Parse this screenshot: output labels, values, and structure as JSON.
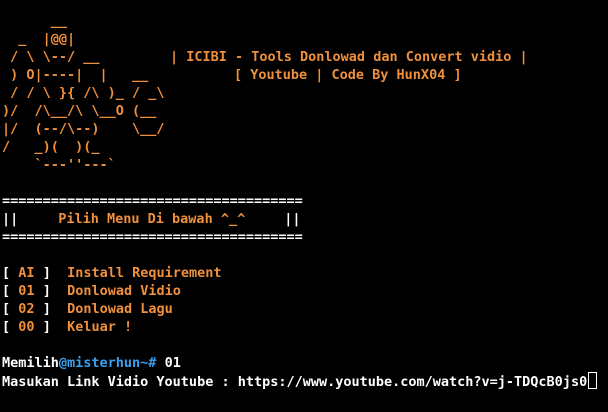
{
  "colors": {
    "background": "#000000",
    "accent_orange": "#f0903c",
    "text_white": "#ffffff",
    "host_blue": "#3aa0f0"
  },
  "banner": {
    "art": [
      "      __",
      "  _  |@@|",
      " / \\ \\--/ __",
      " ) O|----|  |   __",
      " / / \\ }{ /\\ )_ / _\\",
      ")/  /\\__/\\ \\__O (__",
      "|/  (--/\\--)    \\__/",
      "/   _)(  )(_",
      "    `---''---`"
    ],
    "title": "| ICIBI - Tools Donlowad dan Convert vidio |",
    "subtitle": "[ Youtube | Code By HunX04 ]"
  },
  "menu_box": {
    "border": "=====================================",
    "left_bar": "||",
    "title": "Pilih Menu Di bawah ^_^",
    "right_bar": "||"
  },
  "menu": {
    "items": [
      {
        "open": "[",
        "key": "AI",
        "close": "]",
        "label": "Install Requirement"
      },
      {
        "open": "[",
        "key": "01",
        "close": "]",
        "label": "Donlowad Vidio"
      },
      {
        "open": "[",
        "key": "02",
        "close": "]",
        "label": "Donlowad Lagu"
      },
      {
        "open": "[",
        "key": "00",
        "close": "]",
        "label": "Keluar !"
      }
    ]
  },
  "prompt": {
    "prefix": "Memilih",
    "host": "@misterhun~#",
    "input": " 01"
  },
  "link_prompt": {
    "label": "Masukan Link Vidio Youtube : ",
    "value": "https://www.youtube.com/watch?v=j-TDQcB0js0"
  }
}
